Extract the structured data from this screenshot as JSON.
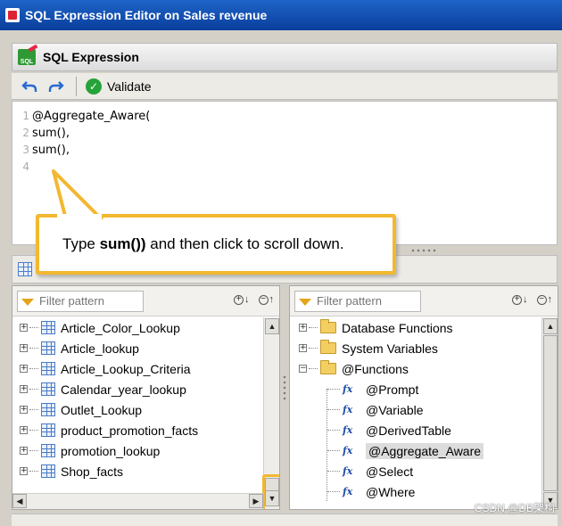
{
  "window": {
    "title": "SQL Expression Editor on Sales revenue"
  },
  "panel": {
    "title": "SQL Expression"
  },
  "toolbar": {
    "undo_icon": "undo-icon",
    "redo_icon": "redo-icon",
    "validate_label": "Validate"
  },
  "editor": {
    "lines": [
      {
        "num": "1",
        "text": "@Aggregate_Aware("
      },
      {
        "num": "2",
        "text": "sum(),"
      },
      {
        "num": "3",
        "text": "sum(),"
      },
      {
        "num": "4",
        "text": ""
      }
    ]
  },
  "callout": {
    "prefix": "Type ",
    "bold": "sum())",
    "suffix": " and then click to scroll down."
  },
  "left_pane": {
    "filter_placeholder": "Filter pattern",
    "items": [
      "Article_Color_Lookup",
      "Article_lookup",
      "Article_Lookup_Criteria",
      "Calendar_year_lookup",
      "Outlet_Lookup",
      "product_promotion_facts",
      "promotion_lookup",
      "Shop_facts"
    ]
  },
  "right_pane": {
    "filter_placeholder": "Filter pattern",
    "folders": [
      {
        "label": "Database Functions",
        "toggle": "+"
      },
      {
        "label": "System Variables",
        "toggle": "+"
      },
      {
        "label": "@Functions",
        "toggle": "−"
      }
    ],
    "functions": [
      "@Prompt",
      "@Variable",
      "@DerivedTable",
      "@Aggregate_Aware",
      "@Select",
      "@Where"
    ],
    "selected": "@Aggregate_Aware"
  },
  "controls": {
    "expand_all": "+",
    "collapse_all": "−",
    "fx_glyph": "fx"
  },
  "watermark": "CSDN @DB架构"
}
